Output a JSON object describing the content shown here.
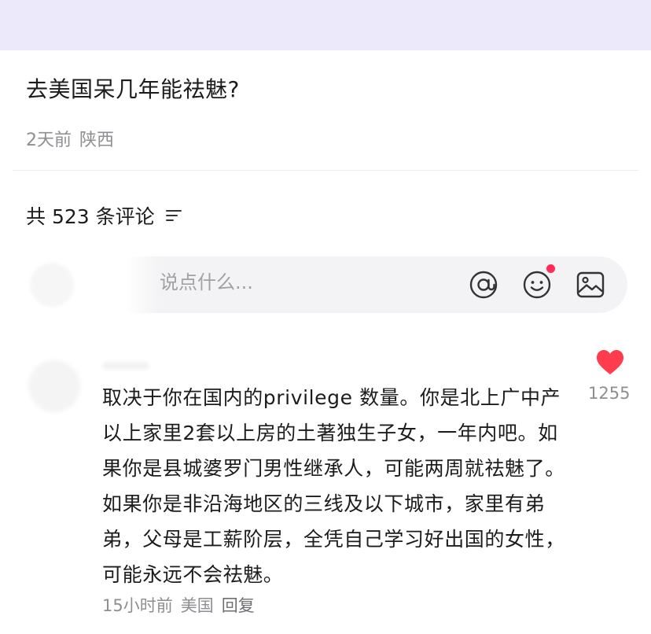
{
  "post": {
    "title": "去美国呆几年能祛魅?",
    "time": "2天前",
    "location": "陕西"
  },
  "comments_header": {
    "label": "共 523 条评论"
  },
  "composer": {
    "placeholder": "说点什么..."
  },
  "comment": {
    "text": "取决于你在国内的privilege 数量。你是北上广中产以上家里2套以上房的土著独生子女，一年内吧。如果你是县城婆罗门男性继承人，可能两周就祛魅了。如果你是非沿海地区的三线及以下城市，家里有弟弟，父母是工薪阶层，全凭自己学习好出国的女性，可能永远不会祛魅。",
    "time": "15小时前",
    "location": "美国",
    "reply_label": "回复",
    "like_count": "1255"
  },
  "colors": {
    "top_band": "#ebe9fa",
    "like_red": "#ff3b4e",
    "notification_dot": "#ff2d55",
    "meta_gray": "#8e8e93"
  },
  "icons": [
    "sort-icon",
    "at-icon",
    "emoji-icon",
    "image-icon",
    "heart-icon"
  ]
}
